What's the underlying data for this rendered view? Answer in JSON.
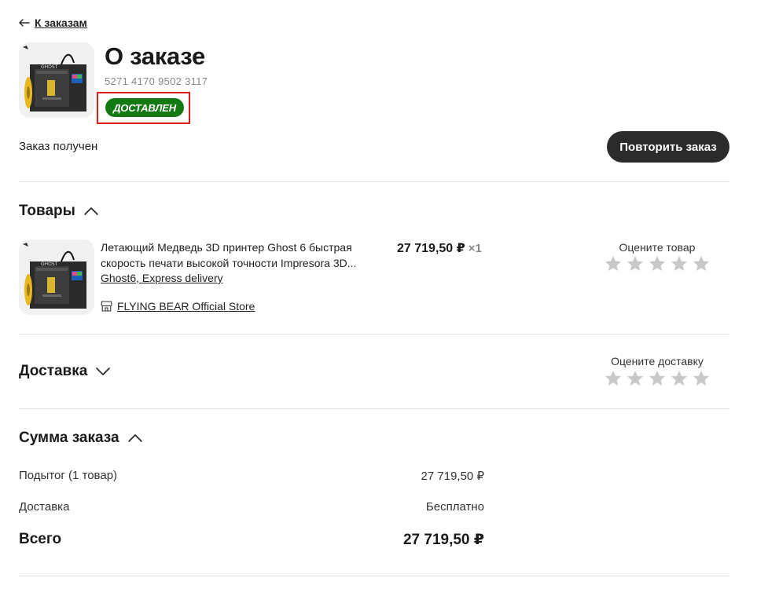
{
  "nav": {
    "back_label": "К заказам"
  },
  "order": {
    "title": "О заказе",
    "number": "5271 4170 9502 3117",
    "status": "ДОСТАВЛЕН",
    "status_color": "#137a13",
    "received_text": "Заказ получен",
    "repeat_button": "Повторить заказ"
  },
  "products_section": {
    "title": "Товары",
    "items": [
      {
        "title": "Летающий Медведь 3D принтер Ghost 6 быстрая скорость печати высокой точности Impresora 3D...",
        "variant": "Ghost6, Express delivery",
        "store": "FLYING BEAR Official Store",
        "price": "27 719,50 ₽",
        "qty": "×1",
        "rate_label": "Оцените товар"
      }
    ]
  },
  "delivery_section": {
    "title": "Доставка",
    "rate_label": "Оцените доставку"
  },
  "summary_section": {
    "title": "Сумма заказа",
    "subtotal_label": "Подытог (1 товар)",
    "subtotal_value": "27 719,50 ₽",
    "delivery_label": "Доставка",
    "delivery_value": "Бесплатно",
    "total_label": "Всего",
    "total_value": "27 719,50 ₽"
  }
}
